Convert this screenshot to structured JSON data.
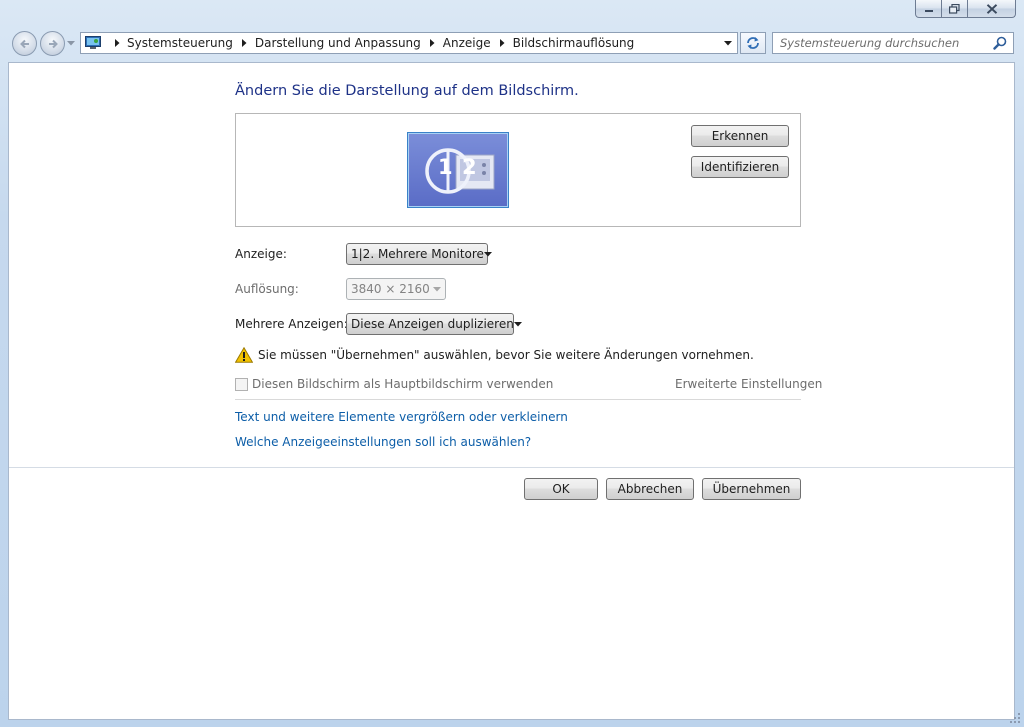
{
  "window": {
    "caption": {
      "minimize_icon": "minimize-icon",
      "maximize_icon": "restore-icon",
      "close_icon": "close-icon"
    }
  },
  "nav": {
    "back_icon": "back-arrow-icon",
    "forward_icon": "forward-arrow-icon",
    "breadcrumbs": [
      "Systemsteuerung",
      "Darstellung und Anpassung",
      "Anzeige",
      "Bildschirmauflösung"
    ],
    "search_placeholder": "Systemsteuerung durchsuchen"
  },
  "main": {
    "heading": "Ändern Sie die Darstellung auf dem Bildschirm.",
    "monitor_preview": {
      "label1": "1",
      "label2": "2"
    },
    "detect_button": "Erkennen",
    "identify_button": "Identifizieren",
    "display_label": "Anzeige:",
    "display_value": "1|2. Mehrere Monitore",
    "resolution_label": "Auflösung:",
    "resolution_value": "3840 × 2160",
    "multi_display_label": "Mehrere Anzeigen:",
    "multi_display_value": "Diese Anzeigen duplizieren",
    "warning_text": "Sie müssen \"Übernehmen\" auswählen, bevor Sie weitere Änderungen vornehmen.",
    "primary_checkbox_label": "Diesen Bildschirm als Hauptbildschirm verwenden",
    "advanced_link": "Erweiterte Einstellungen",
    "link_text_size": "Text und weitere Elemente vergrößern oder verkleinern",
    "link_which_settings": "Welche Anzeigeeinstellungen soll ich auswählen?"
  },
  "footer": {
    "ok_button": "OK",
    "cancel_button": "Abbrechen",
    "apply_button": "Übernehmen"
  },
  "colors": {
    "heading": "#1e3287",
    "link": "#0d5ea8",
    "monitor_fill": "#5a6cc6",
    "warning": "#f2c200"
  }
}
